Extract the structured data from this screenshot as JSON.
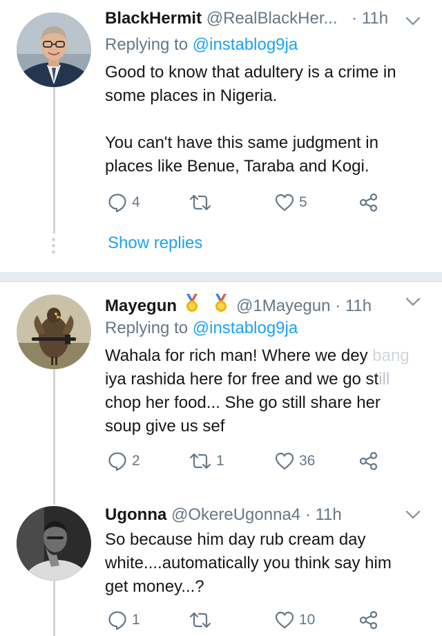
{
  "tweets": [
    {
      "name": "BlackHermit",
      "handle": "@RealBlackHer...",
      "sep": "·",
      "time": "11h",
      "replying_prefix": "Replying to",
      "replying_to": "@instablog9ja",
      "body": "Good to know that adultery is a crime in some places in Nigeria.\n\nYou can't have this same judgment in places like Benue, Taraba and Kogi.",
      "replies": "4",
      "retweets": "",
      "likes": "5",
      "show_replies": "Show replies"
    },
    {
      "name": "Mayegun",
      "handle": "@1Mayegun",
      "sep": "·",
      "time": "11h",
      "replying_prefix": "Replying to",
      "replying_to": "@instablog9ja",
      "body_line1": "Wahala for rich man!  Where we dey",
      "body_line1_faded": "bang",
      "body_line2a": "iya rashida here for free and we go st",
      "body_line2b": "ill",
      "body_rest": "chop her food...  She go still share her\nsoup give us sef",
      "replies": "2",
      "retweets": "1",
      "likes": "36"
    },
    {
      "name": "Ugonna",
      "handle": "@OkereUgonna4",
      "sep": "·",
      "time": "11h",
      "body": "So because him day rub cream day white....automatically you think say him get money...?",
      "replies": "1",
      "retweets": "",
      "likes": "10"
    }
  ],
  "colors": {
    "text": "#14171a",
    "secondary": "#657786",
    "link": "#1da1f2",
    "thread": "#ccd6dd",
    "divider": "#e6ecf0"
  }
}
